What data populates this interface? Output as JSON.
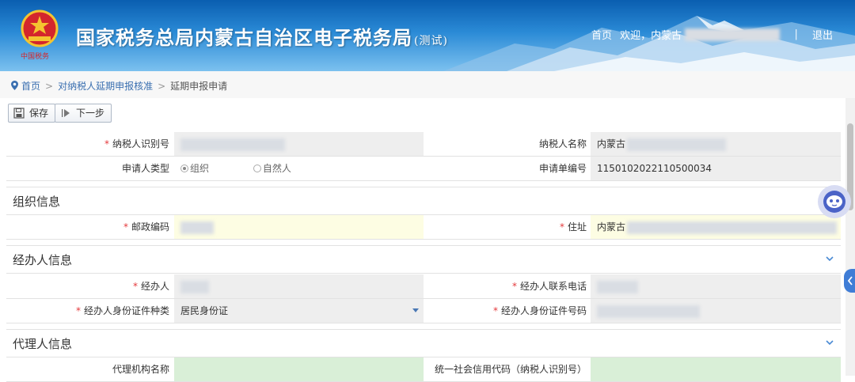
{
  "header": {
    "site_title": "国家税务总局内蒙古自治区电子税务局",
    "site_title_suffix": "(测试)",
    "nav_home": "首页",
    "welcome": "欢迎，内蒙古",
    "logout": "退出",
    "divider": "|"
  },
  "breadcrumb": {
    "items": [
      "首页",
      "对纳税人延期申报核准",
      "延期申报申请"
    ],
    "separator": ">"
  },
  "toolbar": {
    "save_label": "保存",
    "next_label": "下一步"
  },
  "form": {
    "taxpayer_id_label": "纳税人识别号",
    "taxpayer_name_label": "纳税人名称",
    "taxpayer_name_value": "内蒙古",
    "applicant_type_label": "申请人类型",
    "applicant_type_options": [
      "组织",
      "自然人"
    ],
    "applicant_type_selected": "组织",
    "application_no_label": "申请单编号",
    "application_no_value": "1150102022110500034"
  },
  "sections": {
    "org": {
      "title": "组织信息",
      "postcode_label": "邮政编码",
      "address_label": "住址",
      "address_value": "内蒙古"
    },
    "handler": {
      "title": "经办人信息",
      "name_label": "经办人",
      "phone_label": "经办人联系电话",
      "id_type_label": "经办人身份证件种类",
      "id_type_value": "居民身份证",
      "id_no_label": "经办人身份证件号码"
    },
    "agent": {
      "title": "代理人信息",
      "org_name_label": "代理机构名称",
      "credit_code_label": "统一社会信用代码（纳税人识别号）"
    }
  },
  "colors": {
    "header_blue": "#0a5eb0",
    "link_blue": "#3a6fb0",
    "required": "#e4393c",
    "readonly_bg": "#eeeeee",
    "editable_bg": "#fdfde3",
    "agent_bg": "#d9efd7"
  },
  "icons": [
    "tax-emblem-icon",
    "location-pin-icon",
    "save-icon",
    "next-icon",
    "chevron-down-icon",
    "robot-assistant-icon"
  ]
}
